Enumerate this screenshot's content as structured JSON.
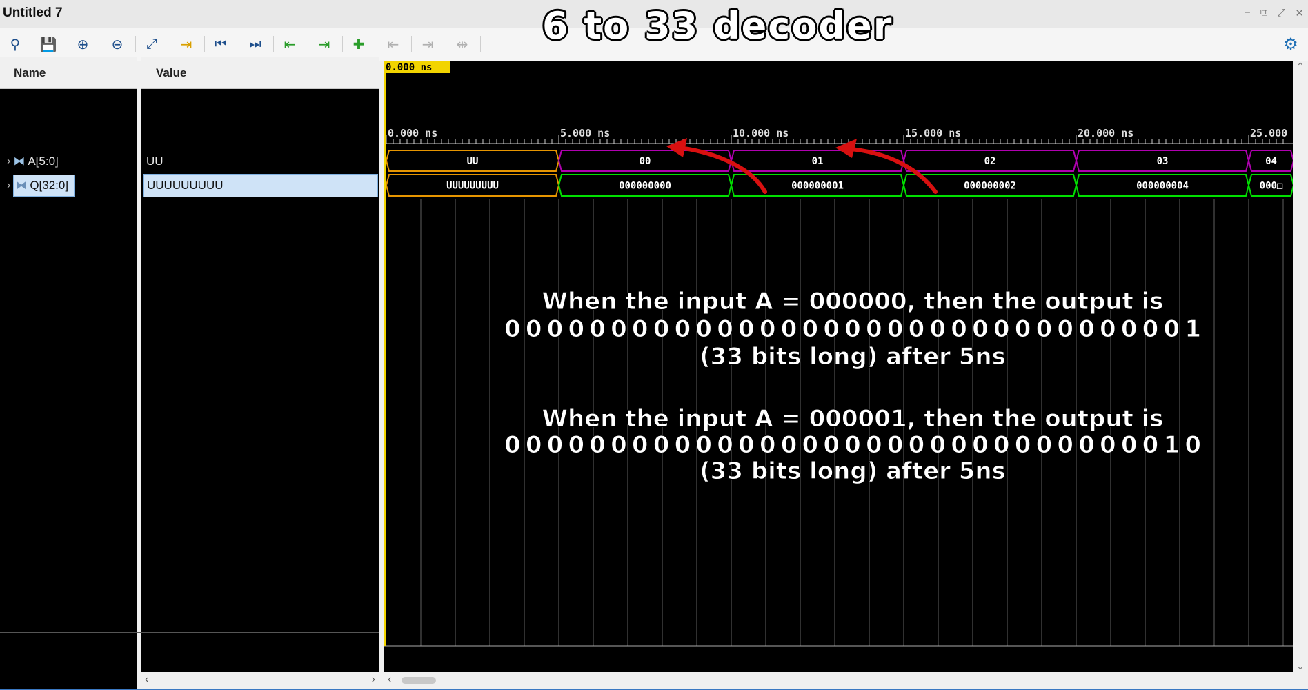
{
  "window": {
    "title": "Untitled 7"
  },
  "headline": "6 to 33 decoder",
  "toolbar": {
    "buttons": [
      {
        "name": "search-icon",
        "glyph": "⚲",
        "color": "#1e4f8c"
      },
      {
        "name": "save-icon",
        "glyph": "💾",
        "color": "#1e4f8c"
      },
      {
        "name": "zoom-in-icon",
        "glyph": "⊕",
        "color": "#1e4f8c"
      },
      {
        "name": "zoom-out-icon",
        "glyph": "⊖",
        "color": "#1e4f8c"
      },
      {
        "name": "zoom-fit-icon",
        "glyph": "⤢",
        "color": "#1e4f8c"
      },
      {
        "name": "goto-cursor-icon",
        "glyph": "⇥",
        "color": "#d9a000"
      },
      {
        "name": "goto-start-icon",
        "glyph": "⏮",
        "color": "#1e4f8c"
      },
      {
        "name": "goto-end-icon",
        "glyph": "⏭",
        "color": "#1e4f8c"
      },
      {
        "name": "prev-transition-icon",
        "glyph": "⇤",
        "color": "#2a9d2a"
      },
      {
        "name": "next-transition-icon",
        "glyph": "⇥",
        "color": "#2a9d2a"
      },
      {
        "name": "add-marker-icon",
        "glyph": "✚",
        "color": "#2a9d2a"
      },
      {
        "name": "prev-marker-icon",
        "glyph": "⇤",
        "color": "#b0b0b0"
      },
      {
        "name": "next-marker-icon",
        "glyph": "⇥",
        "color": "#b0b0b0"
      },
      {
        "name": "swap-cursors-icon",
        "glyph": "⇹",
        "color": "#b0b0b0"
      }
    ]
  },
  "columns": {
    "name": "Name",
    "value": "Value"
  },
  "signals": [
    {
      "name": "A[5:0]",
      "value": "UU",
      "selected": false
    },
    {
      "name": "Q[32:0]",
      "value": "UUUUUUUUU",
      "selected": true
    }
  ],
  "cursor_time": "0.000 ns",
  "timeline": {
    "ticks": [
      "0.000 ns",
      "5.000 ns",
      "10.000 ns",
      "15.000 ns",
      "20.000 ns",
      "25.000"
    ],
    "tick_ns": [
      0,
      5,
      10,
      15,
      20,
      25
    ]
  },
  "waves": {
    "A": {
      "color": "#b000b0",
      "first_color": "#e69500",
      "segments": [
        {
          "start": 0,
          "end": 5,
          "label": "UU"
        },
        {
          "start": 5,
          "end": 10,
          "label": "00"
        },
        {
          "start": 10,
          "end": 15,
          "label": "01"
        },
        {
          "start": 15,
          "end": 20,
          "label": "02"
        },
        {
          "start": 20,
          "end": 25,
          "label": "03"
        },
        {
          "start": 25,
          "end": 26.3,
          "label": "04"
        }
      ]
    },
    "Q": {
      "color": "#00e000",
      "first_color": "#e69500",
      "segments": [
        {
          "start": 0,
          "end": 5,
          "label": "UUUUUUUUU"
        },
        {
          "start": 5,
          "end": 10,
          "label": "000000000"
        },
        {
          "start": 10,
          "end": 15,
          "label": "000000001"
        },
        {
          "start": 15,
          "end": 20,
          "label": "000000002"
        },
        {
          "start": 20,
          "end": 25,
          "label": "000000004"
        },
        {
          "start": 25,
          "end": 26.3,
          "label": "000□"
        }
      ]
    }
  },
  "annotations": [
    [
      "When the input A = 000000, then the output is",
      "000000000000000000000000000000001",
      "(33 bits long) after 5ns"
    ],
    [
      "When the input A = 000001, then the output is",
      "000000000000000000000000000000010",
      "(33 bits long) after 5ns"
    ]
  ],
  "window_controls": [
    "−",
    "⧉",
    "⤢",
    "✕"
  ]
}
